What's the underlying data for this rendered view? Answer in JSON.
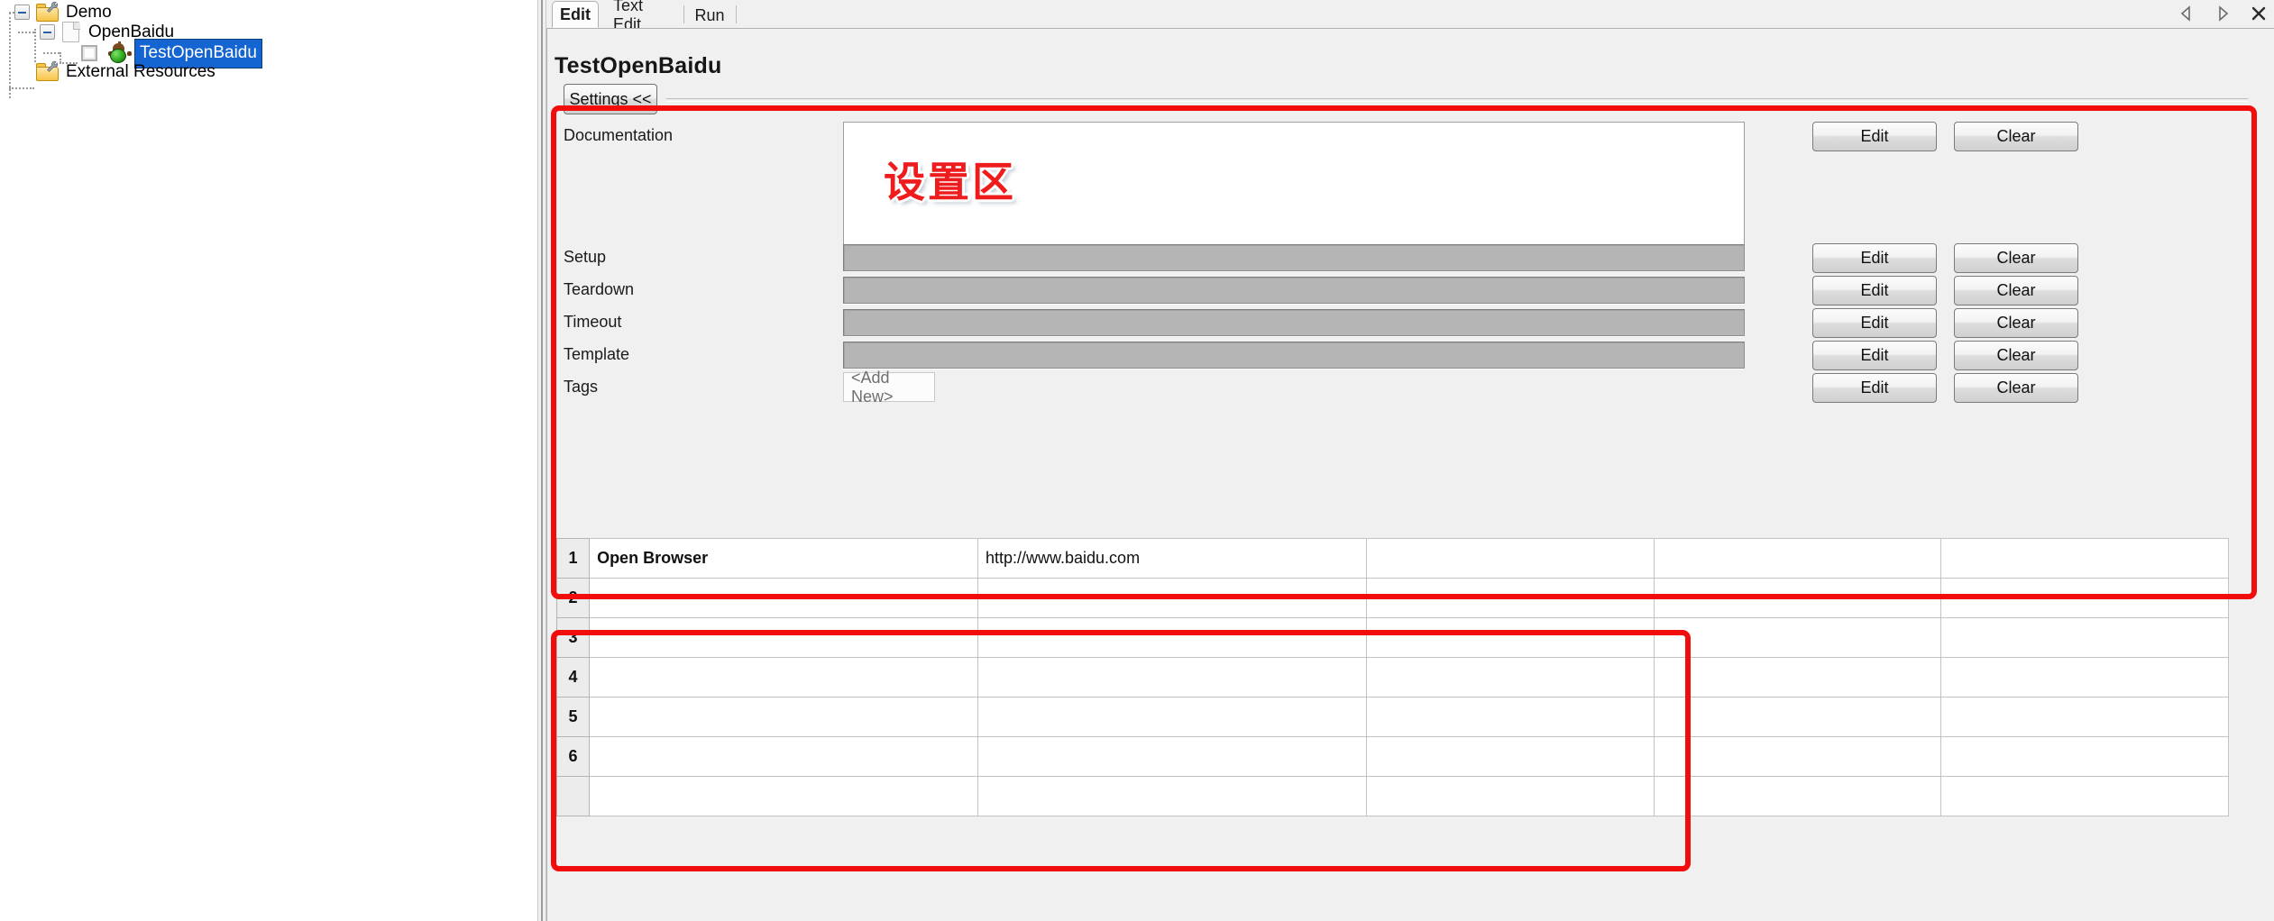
{
  "tree": {
    "items": [
      {
        "label": "Demo",
        "icon": "folder-wrench-icon",
        "depth": 0,
        "selected": false
      },
      {
        "label": "OpenBaidu",
        "icon": "document-icon",
        "depth": 1,
        "selected": false
      },
      {
        "label": "TestOpenBaidu",
        "icon": "robot-test-icon",
        "depth": 2,
        "selected": true
      },
      {
        "label": "External Resources",
        "icon": "folder-wrench-icon",
        "depth": 1,
        "selected": false
      }
    ]
  },
  "tabs": {
    "items": [
      {
        "label": "Edit",
        "active": true
      },
      {
        "label": "Text Edit",
        "active": false
      },
      {
        "label": "Run",
        "active": false
      }
    ],
    "controls": [
      {
        "name": "prev-tab-button",
        "glyph": "◁"
      },
      {
        "name": "next-tab-button",
        "glyph": "▷"
      },
      {
        "name": "close-tab-button",
        "glyph": "✕"
      }
    ]
  },
  "editor": {
    "title": "TestOpenBaidu",
    "settings_toggle_label": "Settings <<",
    "annotation_text": "设置区",
    "rows": [
      {
        "label": "Documentation",
        "field": "textarea",
        "value": "",
        "edit_label": "Edit",
        "clear_label": "Clear"
      },
      {
        "label": "Setup",
        "field": "input",
        "value": "",
        "edit_label": "Edit",
        "clear_label": "Clear"
      },
      {
        "label": "Teardown",
        "field": "input",
        "value": "",
        "edit_label": "Edit",
        "clear_label": "Clear"
      },
      {
        "label": "Timeout",
        "field": "input",
        "value": "",
        "edit_label": "Edit",
        "clear_label": "Clear"
      },
      {
        "label": "Template",
        "field": "input",
        "value": "",
        "edit_label": "Edit",
        "clear_label": "Clear"
      },
      {
        "label": "Tags",
        "field": "addnew",
        "value": "<Add New>",
        "edit_label": "Edit",
        "clear_label": "Clear"
      }
    ]
  },
  "grid": {
    "rows": [
      {
        "num": "1",
        "cells": [
          "Open Browser",
          "http://www.baidu.com",
          "",
          "",
          ""
        ],
        "highlight": true
      },
      {
        "num": "2",
        "cells": [
          "",
          "",
          "",
          "",
          ""
        ],
        "highlight": false
      },
      {
        "num": "3",
        "cells": [
          "",
          "",
          "",
          "",
          ""
        ],
        "highlight": false
      },
      {
        "num": "4",
        "cells": [
          "",
          "",
          "",
          "",
          ""
        ],
        "highlight": false
      },
      {
        "num": "5",
        "cells": [
          "",
          "",
          "",
          "",
          ""
        ],
        "highlight": false
      },
      {
        "num": "6",
        "cells": [
          "",
          "",
          "",
          "",
          ""
        ],
        "highlight": false
      }
    ]
  },
  "colors": {
    "annotation_red": "#f20d0d",
    "keyword_blue": "#1a63c8",
    "selection_blue": "#1464d2",
    "panel_gray": "#f0f0f0",
    "field_gray": "#b5b5b5"
  }
}
